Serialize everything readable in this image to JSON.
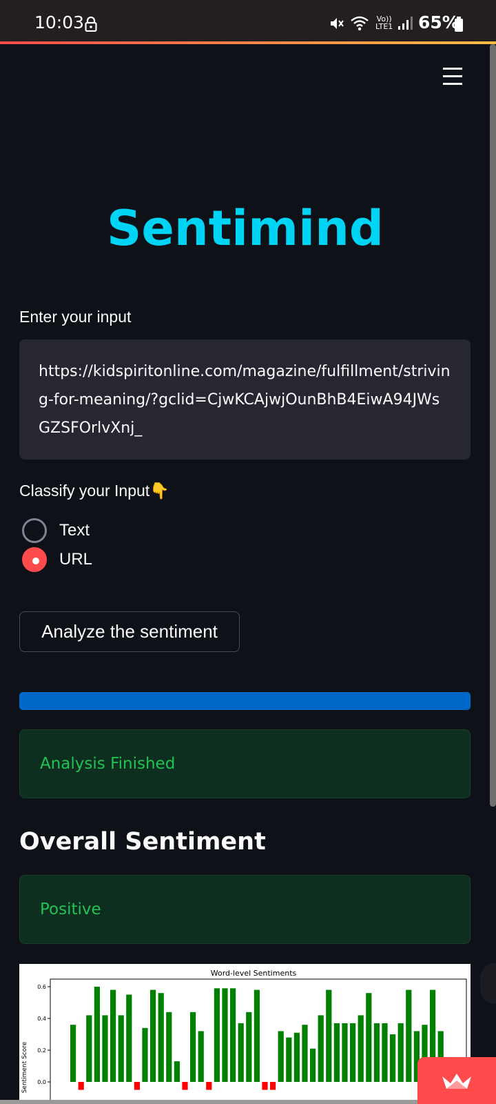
{
  "status_bar": {
    "time": "10:03",
    "volte_top": "Vo))",
    "volte_bottom": "LTE1",
    "battery": "65%",
    "icons": [
      "lock-icon",
      "mute-icon",
      "wifi-icon",
      "volte-icon",
      "signal-icon",
      "battery-icon"
    ]
  },
  "header": {
    "menu_icon": "hamburger-menu-icon"
  },
  "app": {
    "title": "Sentimind",
    "input_label": "Enter your input",
    "input_value": "https://kidspiritonline.com/magazine/fulfillment/striving-for-meaning/?gclid=CjwKCAjwjOunBhB4EiwA94JWsGZSFOrlvXnj_",
    "classify_label": "Classify your Input",
    "classify_emoji": "👇",
    "options": [
      {
        "label": "Text",
        "selected": false
      },
      {
        "label": "URL",
        "selected": true
      }
    ],
    "analyze_button": "Analyze the sentiment",
    "progress": 1.0,
    "status_message": "Analysis Finished",
    "overall_heading": "Overall Sentiment",
    "overall_result": "Positive"
  },
  "colors": {
    "title": "#00d4f5",
    "accent": "#ff4b4b",
    "progress": "#0068c9",
    "success_text": "#21c354",
    "positive_bar": "#008000",
    "negative_bar": "#ff0000"
  },
  "chart_data": {
    "type": "bar",
    "title": "Word-level Sentiments",
    "ylabel": "Sentiment Score",
    "xlabel": "",
    "ylim": [
      -0.05,
      0.63
    ],
    "yticks": [
      "0.0",
      "0.2",
      "0.4",
      "0.6"
    ],
    "values": [
      0.36,
      -0.05,
      0.42,
      0.6,
      0.42,
      0.58,
      0.42,
      0.55,
      -0.05,
      0.34,
      0.58,
      0.56,
      0.44,
      0.13,
      -0.05,
      0.44,
      0.32,
      -0.05,
      0.59,
      0.59,
      0.59,
      0.37,
      0.44,
      0.58,
      -0.05,
      -0.05,
      0.32,
      0.28,
      0.31,
      0.36,
      0.21,
      0.42,
      0.58,
      0.37,
      0.37,
      0.37,
      0.42,
      0.56,
      0.37,
      0.37,
      0.3,
      0.37,
      0.58,
      0.32,
      0.36,
      0.58,
      0.32
    ],
    "colors_by_sign": {
      "positive": "#008000",
      "negative": "#ff0000"
    }
  },
  "badge": {
    "icon": "streamlit-crown-icon"
  }
}
